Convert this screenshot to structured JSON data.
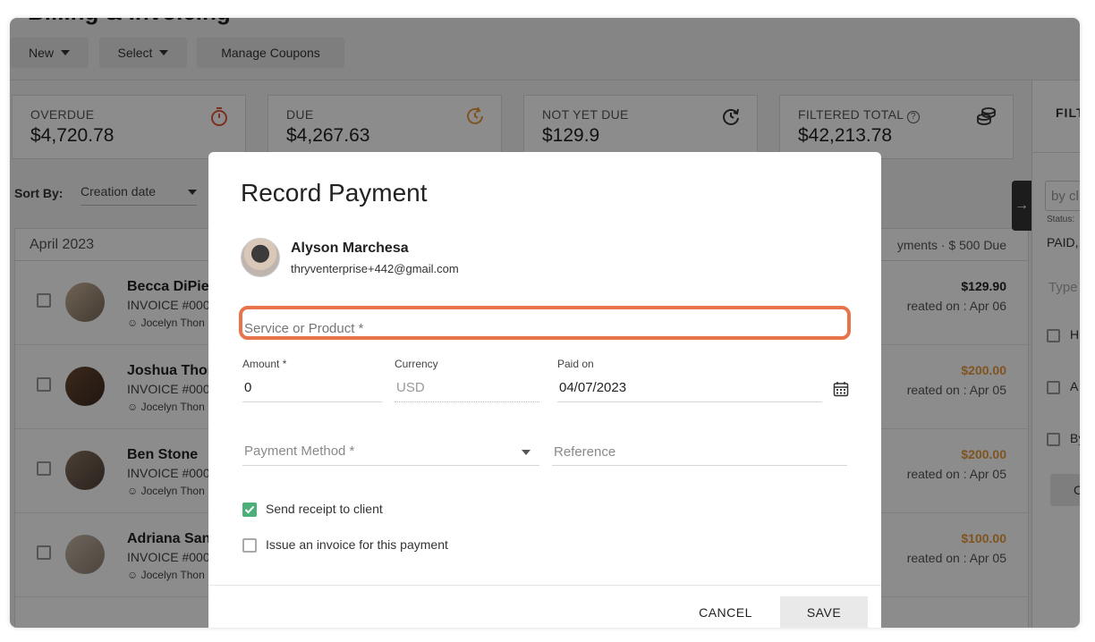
{
  "page": {
    "title": "Billing & Invoicing"
  },
  "toolbar": {
    "new_label": "New",
    "select_label": "Select",
    "coupons_label": "Manage Coupons"
  },
  "summary": [
    {
      "label": "OVERDUE",
      "value": "$4,720.78",
      "icon": "stopwatch-icon",
      "color": "#e2583e"
    },
    {
      "label": "DUE",
      "value": "$4,267.63",
      "icon": "clock-refresh-icon",
      "color": "#e89a3c"
    },
    {
      "label": "NOT YET DUE",
      "value": "$129.9",
      "icon": "clock-forward-icon",
      "color": "#333333"
    },
    {
      "label": "FILTERED TOTAL",
      "value": "$42,213.78",
      "icon": "coins-icon",
      "color": "#333333"
    }
  ],
  "sort": {
    "label": "Sort By:",
    "value": "Creation date"
  },
  "list": {
    "month": "April 2023",
    "summary": "yments  · $ 500 Due",
    "rows": [
      {
        "name": "Becca DiPiet",
        "invoice": "INVOICE #000",
        "owner": "Jocelyn Thon",
        "amount": "$129.90",
        "amount_color": "#222222",
        "created": "reated on : Apr 06"
      },
      {
        "name": "Joshua Thon",
        "invoice": "INVOICE #000",
        "owner": "Jocelyn Thon",
        "amount": "$200.00",
        "amount_color": "#e89a3c",
        "created": "reated on : Apr 05"
      },
      {
        "name": "Ben Stone",
        "invoice": "INVOICE #000",
        "owner": "Jocelyn Thon",
        "amount": "$200.00",
        "amount_color": "#e89a3c",
        "created": "reated on : Apr 05"
      },
      {
        "name": "Adriana San",
        "invoice": "INVOICE #000",
        "owner": "Jocelyn Thon",
        "amount": "$100.00",
        "amount_color": "#e89a3c",
        "created": "reated on : Apr 05"
      }
    ]
  },
  "sidepanel": {
    "header": "FILT",
    "search": "by cl",
    "status_label": "Status:",
    "status_value": "PAID,",
    "type_placeholder": "Type",
    "opt1": "H",
    "opt2": "A",
    "opt3": "By",
    "btn": "C"
  },
  "modal": {
    "title": "Record Payment",
    "client_name": "Alyson Marchesa",
    "client_email": "thryventerprise+442@gmail.com",
    "service_placeholder": "Service or Product *",
    "amount_label": "Amount *",
    "amount_value": "0",
    "currency_label": "Currency",
    "currency_value": "USD",
    "paid_on_label": "Paid on",
    "paid_on_value": "04/07/2023",
    "payment_method_placeholder": "Payment Method *",
    "reference_placeholder": "Reference",
    "send_receipt_label": "Send receipt to client",
    "send_receipt_checked": true,
    "issue_invoice_label": "Issue an invoice for this payment",
    "issue_invoice_checked": false,
    "cancel_label": "CANCEL",
    "save_label": "SAVE",
    "highlight_color": "#e8744b"
  }
}
